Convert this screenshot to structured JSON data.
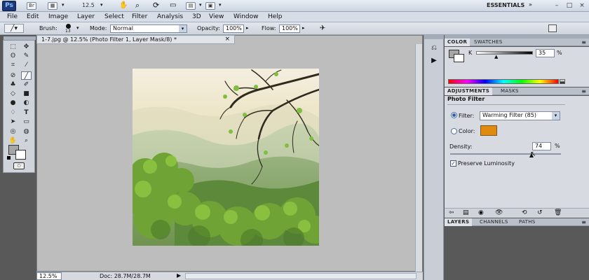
{
  "app": {
    "logo": "Ps",
    "zoom_value": "12.5",
    "workspace": "ESSENTIALS",
    "window_min": "–",
    "window_max": "□",
    "window_close": "×"
  },
  "menu": [
    "File",
    "Edit",
    "Image",
    "Layer",
    "Select",
    "Filter",
    "Analysis",
    "3D",
    "View",
    "Window",
    "Help"
  ],
  "options": {
    "brush_label": "Brush:",
    "brush_size": "13",
    "mode_label": "Mode:",
    "mode_value": "Normal",
    "opacity_label": "Opacity:",
    "opacity_value": "100%",
    "flow_label": "Flow:",
    "flow_value": "100%"
  },
  "document": {
    "tab_title": "1-7.jpg @ 12.5% (Photo Filter 1, Layer Mask/8) *",
    "tab_close": "×"
  },
  "status": {
    "zoom": "12.5%",
    "doc_info": "Doc: 28.7M/28.7M"
  },
  "color_panel": {
    "tabs": [
      "COLOR",
      "SWATCHES"
    ],
    "k_label": "K",
    "k_value": "35",
    "k_unit": "%"
  },
  "adjustments_panel": {
    "tabs": [
      "ADJUSTMENTS",
      "MASKS"
    ],
    "title": "Photo Filter",
    "filter_label": "Filter:",
    "filter_value": "Warming Filter (85)",
    "color_label": "Color:",
    "swatch_color": "#e08a10",
    "density_label": "Density:",
    "density_value": "74",
    "density_unit": "%",
    "density_level": 0.74,
    "preserve_label": "Preserve Luminosity",
    "preserve_checked": "true"
  },
  "layers_panel": {
    "tabs": [
      "LAYERS",
      "CHANNELS",
      "PATHS"
    ]
  },
  "colors": {
    "chrome": "#d7dbe1",
    "workspace_bg": "#595959",
    "canvas_bg": "#bdbdbd",
    "accent_blue": "#2b4b8c"
  }
}
